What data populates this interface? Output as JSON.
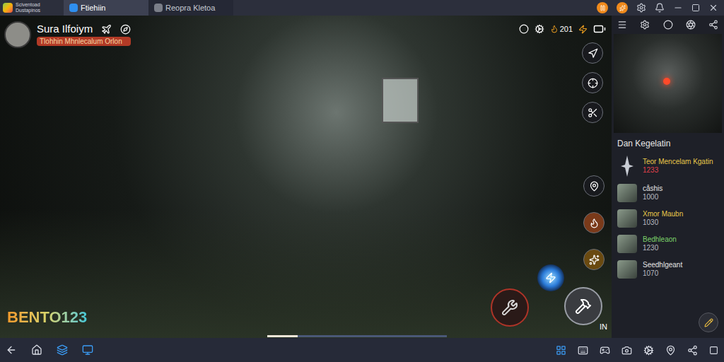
{
  "app": {
    "logo_lines": [
      "Sciventoad",
      "Dustapinos"
    ]
  },
  "tabs": [
    {
      "label": "Ftiehiin",
      "selected": true
    },
    {
      "label": "Reopra Kletoa",
      "selected": false
    }
  ],
  "player": {
    "name": "Sura Ilfoiym",
    "title": "Tlohhin Mhnlecalum Orlon"
  },
  "hud": {
    "counter": "201",
    "watermark": "BENTO123",
    "corner": "IN",
    "progress": 0.17
  },
  "panel": {
    "heading": "Dan Kegelatin",
    "entries": [
      {
        "kind": "emblem",
        "name": "Teor Mencelam Kgatin",
        "score": "1233",
        "color": "#e8c84a"
      },
      {
        "kind": "avatar",
        "name": "cåshis",
        "score": "1000",
        "color": "#e6e6e6"
      },
      {
        "kind": "avatar",
        "name": "Xmor Maubn",
        "score": "1030",
        "color": "#e8c84a"
      },
      {
        "kind": "avatar",
        "name": "Bedhleaon",
        "score": "1230",
        "color": "#7cd36a"
      },
      {
        "kind": "avatar",
        "name": "Seedhlgeant",
        "score": "1070",
        "color": "#e6e6e6"
      }
    ]
  }
}
